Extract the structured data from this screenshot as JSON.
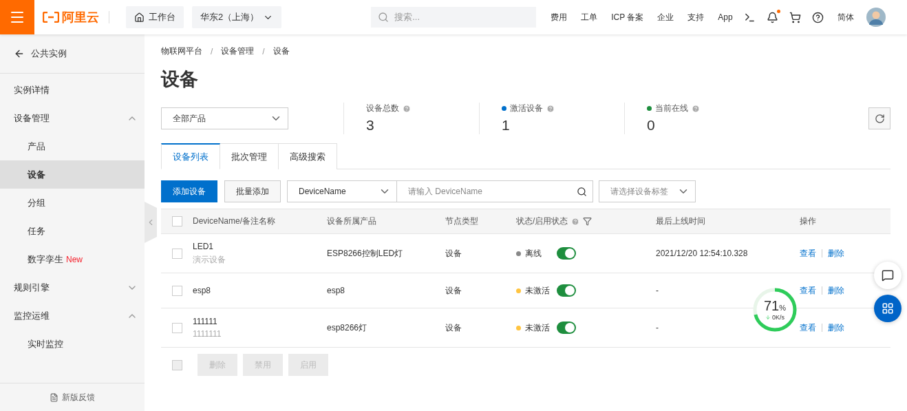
{
  "topbar": {
    "logo": "阿里云",
    "workbench": "工作台",
    "region": "华东2（上海）",
    "search_placeholder": "搜索...",
    "links": [
      "费用",
      "工单",
      "ICP 备案",
      "企业",
      "支持",
      "App"
    ],
    "has_notification": true,
    "language": "简体"
  },
  "sidebar": {
    "back": "公共实例",
    "items": [
      {
        "label": "实例详情",
        "kind": "item",
        "selected": false
      },
      {
        "label": "设备管理",
        "kind": "group",
        "expanded": true,
        "children": [
          {
            "label": "产品",
            "selected": false
          },
          {
            "label": "设备",
            "selected": true
          },
          {
            "label": "分组",
            "selected": false
          },
          {
            "label": "任务",
            "selected": false
          },
          {
            "label": "数字孪生",
            "badge": "New",
            "selected": false
          }
        ]
      },
      {
        "label": "规则引擎",
        "kind": "group",
        "expanded": false
      },
      {
        "label": "监控运维",
        "kind": "group",
        "expanded": true,
        "children": [
          {
            "label": "实时监控",
            "selected": false
          }
        ]
      }
    ],
    "feedback": "新版反馈"
  },
  "breadcrumb": {
    "items": [
      "物联网平台",
      "设备管理",
      "设备"
    ],
    "separator": "/"
  },
  "title": "设备",
  "product_select": "全部产品",
  "stats": [
    {
      "label": "设备总数",
      "value": "3"
    },
    {
      "label": "激活设备",
      "value": "1",
      "color": "#0070cc"
    },
    {
      "label": "当前在线",
      "value": "0",
      "color": "#1e8e3e"
    }
  ],
  "tabs": [
    {
      "label": "设备列表",
      "selected": true
    },
    {
      "label": "批次管理",
      "selected": false
    },
    {
      "label": "高级搜索",
      "selected": false
    }
  ],
  "toolbar": {
    "primary": "添加设备",
    "secondary": "批量添加",
    "filter_field": "DeviceName",
    "search_placeholder": "请输入 DeviceName",
    "tag_placeholder": "请选择设备标签"
  },
  "table": {
    "select_all_checked": false,
    "columns": [
      "DeviceName/备注名称",
      "设备所属产品",
      "节点类型",
      "状态/启用状态",
      "最后上线时间",
      "操作"
    ],
    "rows": [
      {
        "name": "LED1",
        "note": "演示设备",
        "product": "ESP8266控制LED灯",
        "node_type": "设备",
        "status": "离线",
        "color": "#888888",
        "enabled": true,
        "last_online": "2021/12/20 12:54:10.328",
        "actions": [
          "查看",
          "删除"
        ],
        "checked": false
      },
      {
        "name": "esp8",
        "product": "esp8",
        "node_type": "设备",
        "status": "未激活",
        "color": "#ffc440",
        "enabled": true,
        "last_online": "-",
        "actions": [
          "查看",
          "删除"
        ],
        "checked": false
      },
      {
        "name": "111111",
        "note": "1111111",
        "product": "esp8266灯",
        "node_type": "设备",
        "status": "未激活",
        "color": "#ffc440",
        "enabled": true,
        "last_online": "-",
        "actions": [
          "查看",
          "删除"
        ],
        "checked": false
      }
    ],
    "footer_checked": false,
    "footer_buttons": [
      {
        "label": "删除",
        "disabled": true
      },
      {
        "label": "禁用",
        "disabled": true
      },
      {
        "label": "启用",
        "disabled": true
      }
    ]
  },
  "speed_widget": {
    "percent": "71",
    "unit": "%",
    "speed": "0K/s"
  }
}
